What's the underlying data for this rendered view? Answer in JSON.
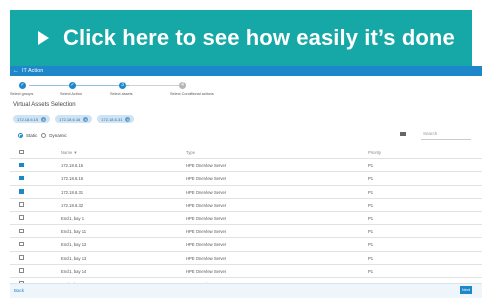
{
  "banner": {
    "text": "Click here to see how easily it’s done"
  },
  "appbar": {
    "back": "←",
    "title": "IT Action"
  },
  "stepper": {
    "steps": [
      {
        "label": "Select groups",
        "state": "done",
        "mark": "✓"
      },
      {
        "label": "Select Action",
        "state": "done",
        "mark": "✓"
      },
      {
        "label": "Select assets",
        "state": "current",
        "mark": "3"
      },
      {
        "label": "Select Conditional actions",
        "state": "pending",
        "mark": "4"
      }
    ]
  },
  "section": {
    "title": "Virtual Assets Selection"
  },
  "chips": [
    "172.18.6.15",
    "172.18.6.16",
    "172.18.6.31"
  ],
  "radios": {
    "static": "Static",
    "dynamic": "Dynamic",
    "selected": "static"
  },
  "search": {
    "placeholder": "Search"
  },
  "table": {
    "headers": {
      "name": "Name ▼",
      "type": "Type",
      "priority": "Priority"
    },
    "rows": [
      {
        "checked": true,
        "name": "172.18.6.15",
        "type": "HPE OneView Server",
        "priority": "P1"
      },
      {
        "checked": true,
        "name": "172.18.6.16",
        "type": "HPE OneView Server",
        "priority": "P1"
      },
      {
        "checked": true,
        "name": "172.18.6.31",
        "type": "HPE OneView Server",
        "priority": "P1"
      },
      {
        "checked": false,
        "name": "172.18.6.32",
        "type": "HPE OneView Server",
        "priority": "P1"
      },
      {
        "checked": false,
        "name": "Encl1, bay 1",
        "type": "HPE OneView Server",
        "priority": "P1"
      },
      {
        "checked": false,
        "name": "Encl1, bay 11",
        "type": "HPE OneView Server",
        "priority": "P1"
      },
      {
        "checked": false,
        "name": "Encl1, bay 12",
        "type": "HPE OneView Server",
        "priority": "P1"
      },
      {
        "checked": false,
        "name": "Encl1, bay 13",
        "type": "HPE OneView Server",
        "priority": "P1"
      },
      {
        "checked": false,
        "name": "Encl1, bay 14",
        "type": "HPE OneView Server",
        "priority": "P1"
      },
      {
        "checked": false,
        "name": "Encl1, bay 15",
        "type": "HPE OneView Server",
        "priority": "P1"
      }
    ]
  },
  "footer": {
    "back": "Back",
    "next": "Next"
  },
  "colors": {
    "banner": "#16a8a6",
    "accent": "#1e87c9"
  }
}
